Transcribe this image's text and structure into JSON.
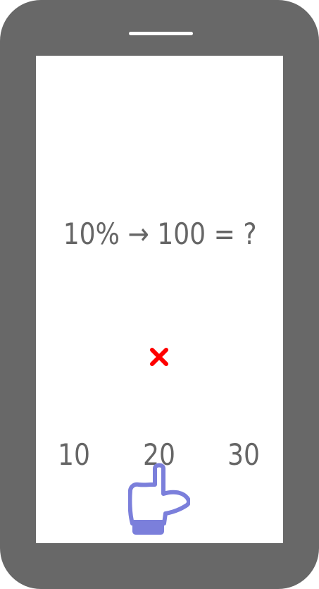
{
  "question": {
    "text": "10% → 100 = ?"
  },
  "feedback": {
    "icon": "cross-icon",
    "color": "#ff0000"
  },
  "answers": [
    {
      "label": "10"
    },
    {
      "label": "20"
    },
    {
      "label": "30"
    }
  ],
  "pointer": {
    "icon": "pointing-hand-icon",
    "color": "#7b7fdb"
  },
  "colors": {
    "device_frame": "#686868",
    "text": "#666666",
    "screen": "#ffffff"
  }
}
